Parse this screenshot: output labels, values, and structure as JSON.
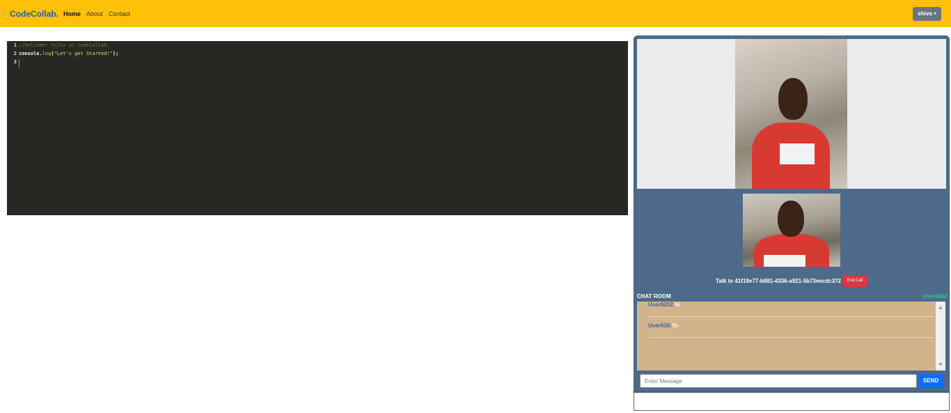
{
  "navbar": {
    "brand": "CodeCollab.",
    "links": [
      "Home",
      "About",
      "Contact"
    ],
    "active_link": "Home",
    "user_menu": "shiva"
  },
  "editor": {
    "lines": [
      {
        "number": "1",
        "tokens": [
          {
            "kind": "comment",
            "text": "//Welcome! folks on CodeCollab"
          }
        ]
      },
      {
        "number": "2",
        "tokens": [
          {
            "kind": "plain",
            "text": "console."
          },
          {
            "kind": "fn",
            "text": "log"
          },
          {
            "kind": "plain",
            "text": "("
          },
          {
            "kind": "str",
            "text": "\"Let's get Started!\""
          },
          {
            "kind": "plain",
            "text": ");"
          }
        ]
      },
      {
        "number": "3",
        "tokens": []
      }
    ],
    "theme_colors": {
      "background": "#272822",
      "comment": "#75715e",
      "function": "#a6e22e",
      "string": "#e6db74"
    }
  },
  "video": {
    "talk_label": "Talk to 41f19e77-b881-4336-a921-5b73eecdc372",
    "end_call_label": "End Call"
  },
  "chat": {
    "title": "CHAT ROOM",
    "current_user": "User8202",
    "messages": [
      {
        "user": "User8202:",
        "text": "hi"
      },
      {
        "user": "User636:",
        "text": "Yo"
      }
    ],
    "input_placeholder": "Enter Message",
    "send_label": "SEND"
  },
  "colors": {
    "navbar": "#ffc107",
    "brand": "#1a5fb4",
    "panel": "#4d6a8a",
    "chat_bg": "#d2b48c",
    "end_call": "#dc3545",
    "send": "#0d6efd",
    "current_user": "#20c997"
  }
}
